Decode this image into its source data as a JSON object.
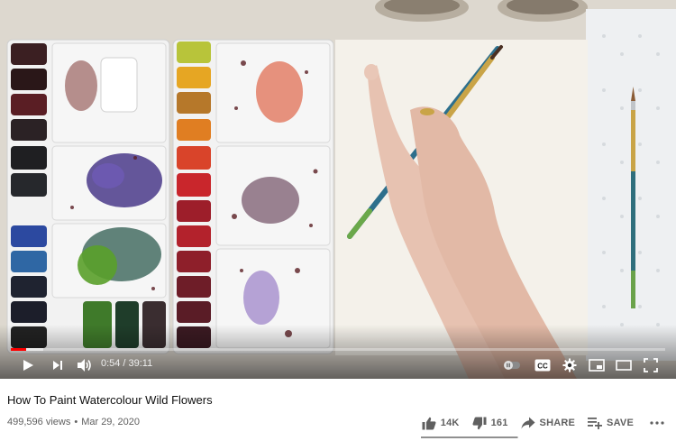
{
  "player": {
    "current_time": "0:54",
    "time_separator": "/",
    "duration": "39:11",
    "progress_fraction": 0.023,
    "loaded_fraction": 0.05,
    "accent": "#ff0000",
    "icons": {
      "play": "play-icon",
      "next": "next-icon",
      "volume": "volume-icon",
      "autoplay": "autoplay-toggle-icon",
      "cc": "cc-icon",
      "settings": "gear-icon",
      "miniplayer": "miniplayer-icon",
      "theater": "theater-icon",
      "fullscreen": "fullscreen-icon"
    },
    "cc_label": "CC"
  },
  "video": {
    "title": "How To Paint Watercolour Wild Flowers",
    "views": "499,596 views",
    "meta_separator": "•",
    "date": "Mar 29, 2020"
  },
  "actions": {
    "like_count": "14K",
    "dislike_count": "161",
    "share_label": "SHARE",
    "save_label": "SAVE",
    "like_ratio": 0.99
  }
}
